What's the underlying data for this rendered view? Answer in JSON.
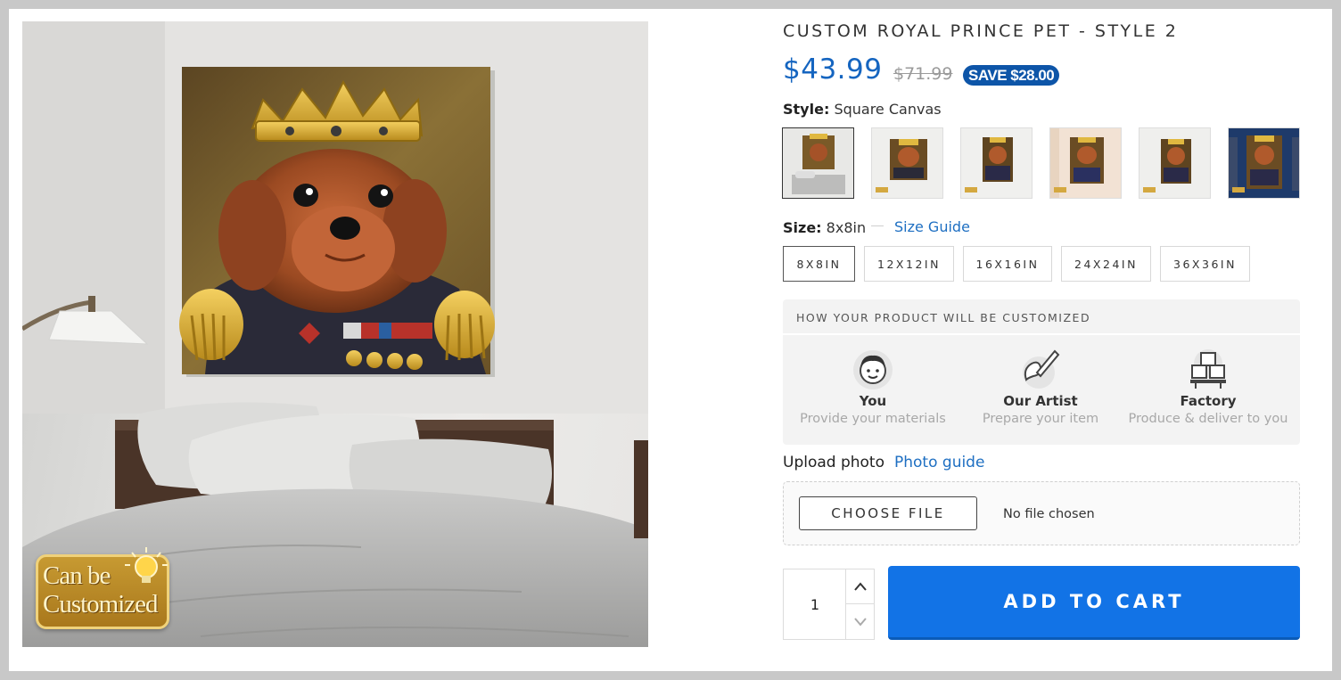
{
  "product": {
    "title": "CUSTOM ROYAL PRINCE PET - STYLE 2",
    "price": "$43.99",
    "compare_price": "$71.99",
    "save_badge": "SAVE $28.00",
    "badge": {
      "line1": "Can be",
      "line2": "Customized"
    }
  },
  "style": {
    "label": "Style:",
    "selected": "Square Canvas",
    "thumbnails": [
      "square-canvas-bedroom",
      "canvas-wall-1",
      "canvas-wall-2",
      "canvas-warm",
      "canvas-wall-3",
      "canvas-bookshelf"
    ]
  },
  "size": {
    "label": "Size:",
    "selected": "8x8in",
    "guide_link": "Size Guide",
    "options": [
      "8X8IN",
      "12X12IN",
      "16X16IN",
      "24X24IN",
      "36X36IN"
    ]
  },
  "customize": {
    "heading": "HOW YOUR PRODUCT WILL BE CUSTOMIZED",
    "steps": [
      {
        "title": "You",
        "subtitle": "Provide your materials",
        "icon": "person-face-icon"
      },
      {
        "title": "Our Artist",
        "subtitle": "Prepare your item",
        "icon": "paintbrush-icon"
      },
      {
        "title": "Factory",
        "subtitle": "Produce & deliver to you",
        "icon": "boxes-icon"
      }
    ]
  },
  "upload": {
    "label": "Upload photo",
    "guide_link": "Photo guide",
    "button": "CHOOSE FILE",
    "status": "No file chosen"
  },
  "cart": {
    "quantity": "1",
    "button": "ADD TO CART"
  },
  "colors": {
    "price": "#1565c0",
    "save_badge": "#0d55a8",
    "cart_button": "#1273e6",
    "link": "#1e6fc2"
  }
}
